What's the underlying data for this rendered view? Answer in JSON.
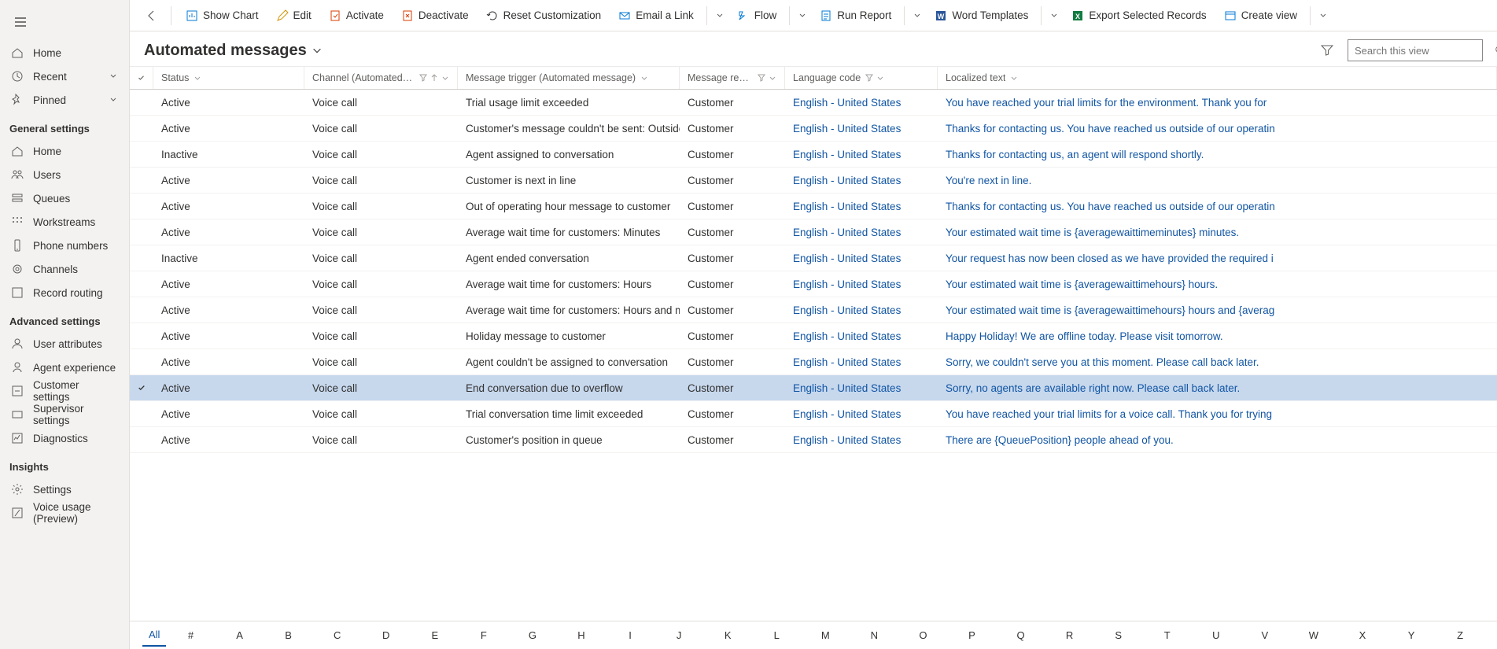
{
  "sidebar_top": [
    {
      "icon": "home",
      "label": "Home"
    },
    {
      "icon": "recent",
      "label": "Recent",
      "chev": true
    },
    {
      "icon": "pin",
      "label": "Pinned",
      "chev": true
    }
  ],
  "sections": [
    {
      "title": "General settings",
      "items": [
        {
          "icon": "home",
          "label": "Home"
        },
        {
          "icon": "users",
          "label": "Users"
        },
        {
          "icon": "queues",
          "label": "Queues"
        },
        {
          "icon": "workstreams",
          "label": "Workstreams"
        },
        {
          "icon": "phone",
          "label": "Phone numbers"
        },
        {
          "icon": "channels",
          "label": "Channels"
        },
        {
          "icon": "routing",
          "label": "Record routing"
        }
      ]
    },
    {
      "title": "Advanced settings",
      "items": [
        {
          "icon": "user",
          "label": "User attributes"
        },
        {
          "icon": "agent",
          "label": "Agent experience"
        },
        {
          "icon": "customer",
          "label": "Customer settings"
        },
        {
          "icon": "supervisor",
          "label": "Supervisor settings"
        },
        {
          "icon": "diag",
          "label": "Diagnostics"
        }
      ]
    },
    {
      "title": "Insights",
      "items": [
        {
          "icon": "settings",
          "label": "Settings"
        },
        {
          "icon": "voice",
          "label": "Voice usage (Preview)"
        }
      ]
    }
  ],
  "commands": [
    {
      "id": "show-chart",
      "label": "Show Chart",
      "icon": "chart",
      "color": "#0078d4"
    },
    {
      "id": "edit",
      "label": "Edit",
      "icon": "edit",
      "color": "#d29200"
    },
    {
      "id": "activate",
      "label": "Activate",
      "icon": "activate",
      "color": "#d83b01"
    },
    {
      "id": "deactivate",
      "label": "Deactivate",
      "icon": "deactivate",
      "color": "#d83b01"
    },
    {
      "id": "reset-customization",
      "label": "Reset Customization",
      "icon": "reset",
      "color": "#323130"
    },
    {
      "id": "email-a-link",
      "label": "Email a Link",
      "icon": "email",
      "color": "#0078d4",
      "split": true
    },
    {
      "id": "flow",
      "label": "Flow",
      "icon": "flow",
      "color": "#0078d4",
      "split": true
    },
    {
      "id": "run-report",
      "label": "Run Report",
      "icon": "report",
      "color": "#0078d4",
      "split": true
    },
    {
      "id": "word-templates",
      "label": "Word Templates",
      "icon": "word",
      "color": "#2b579a",
      "split": true
    },
    {
      "id": "export-selected-records",
      "label": "Export Selected Records",
      "icon": "excel",
      "color": "#107c41"
    },
    {
      "id": "create-view",
      "label": "Create view",
      "icon": "createview",
      "color": "#0078d4",
      "split": true
    }
  ],
  "page_title": "Automated messages",
  "search_placeholder": "Search this view",
  "columns": {
    "status": "Status",
    "channel": "Channel (Automated message)",
    "trigger": "Message trigger (Automated message)",
    "recipient": "Message recipient (...",
    "lang": "Language code",
    "text": "Localized text"
  },
  "rows": [
    {
      "status": "Active",
      "channel": "Voice call",
      "trigger": "Trial usage limit exceeded",
      "recipient": "Customer",
      "lang": "English - United States",
      "text": "You have reached your trial limits for the environment. Thank you for"
    },
    {
      "status": "Active",
      "channel": "Voice call",
      "trigger": "Customer's message couldn't be sent: Outside ...",
      "recipient": "Customer",
      "lang": "English - United States",
      "text": "Thanks for contacting us. You have reached us outside of our operatin"
    },
    {
      "status": "Inactive",
      "channel": "Voice call",
      "trigger": "Agent assigned to conversation",
      "recipient": "Customer",
      "lang": "English - United States",
      "text": "Thanks for contacting us, an agent will respond shortly."
    },
    {
      "status": "Active",
      "channel": "Voice call",
      "trigger": "Customer is next in line",
      "recipient": "Customer",
      "lang": "English - United States",
      "text": "You're next in line."
    },
    {
      "status": "Active",
      "channel": "Voice call",
      "trigger": "Out of operating hour message to customer",
      "recipient": "Customer",
      "lang": "English - United States",
      "text": "Thanks for contacting us. You have reached us outside of our operatin"
    },
    {
      "status": "Active",
      "channel": "Voice call",
      "trigger": "Average wait time for customers: Minutes",
      "recipient": "Customer",
      "lang": "English - United States",
      "text": "Your estimated wait time is {averagewaittimeminutes} minutes."
    },
    {
      "status": "Inactive",
      "channel": "Voice call",
      "trigger": "Agent ended conversation",
      "recipient": "Customer",
      "lang": "English - United States",
      "text": "Your request has now been closed as we have provided the required i"
    },
    {
      "status": "Active",
      "channel": "Voice call",
      "trigger": "Average wait time for customers: Hours",
      "recipient": "Customer",
      "lang": "English - United States",
      "text": "Your estimated wait time is {averagewaittimehours} hours."
    },
    {
      "status": "Active",
      "channel": "Voice call",
      "trigger": "Average wait time for customers: Hours and mi...",
      "recipient": "Customer",
      "lang": "English - United States",
      "text": "Your estimated wait time is {averagewaittimehours} hours and {averag"
    },
    {
      "status": "Active",
      "channel": "Voice call",
      "trigger": "Holiday message to customer",
      "recipient": "Customer",
      "lang": "English - United States",
      "text": "Happy Holiday! We are offline today. Please visit tomorrow."
    },
    {
      "status": "Active",
      "channel": "Voice call",
      "trigger": "Agent couldn't be assigned to conversation",
      "recipient": "Customer",
      "lang": "English - United States",
      "text": "Sorry, we couldn't serve you at this moment. Please call back later."
    },
    {
      "status": "Active",
      "channel": "Voice call",
      "trigger": "End conversation due to overflow",
      "recipient": "Customer",
      "lang": "English - United States",
      "text": "Sorry, no agents are available right now. Please call back later.",
      "selected": true
    },
    {
      "status": "Active",
      "channel": "Voice call",
      "trigger": "Trial conversation time limit exceeded",
      "recipient": "Customer",
      "lang": "English - United States",
      "text": "You have reached your trial limits for a voice call. Thank you for trying"
    },
    {
      "status": "Active",
      "channel": "Voice call",
      "trigger": "Customer's position in queue",
      "recipient": "Customer",
      "lang": "English - United States",
      "text": "There are {QueuePosition} people ahead of you."
    }
  ],
  "alpha": [
    "All",
    "#",
    "A",
    "B",
    "C",
    "D",
    "E",
    "F",
    "G",
    "H",
    "I",
    "J",
    "K",
    "L",
    "M",
    "N",
    "O",
    "P",
    "Q",
    "R",
    "S",
    "T",
    "U",
    "V",
    "W",
    "X",
    "Y",
    "Z"
  ]
}
